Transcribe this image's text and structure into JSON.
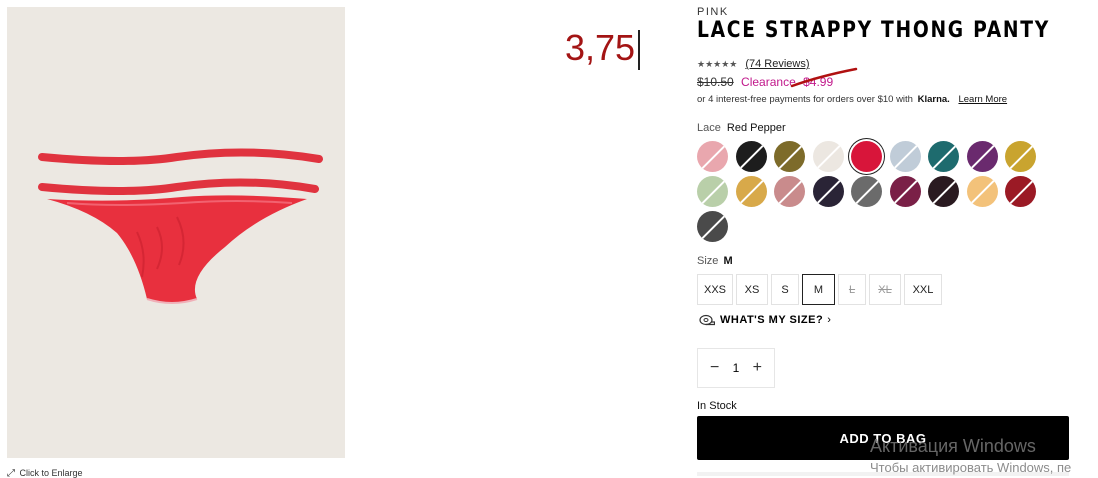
{
  "annotation": {
    "price_text": "3,75"
  },
  "product": {
    "brand": "PINK",
    "title": "LACE STRAPPY THONG PANTY",
    "rating_stars": "★★★★★",
    "reviews_link": "(74 Reviews)",
    "old_price": "$10.50",
    "clearance_label": "Clearance",
    "sale_price": "$4.99",
    "klarna_text": "or 4 interest-free payments for orders over $10 with",
    "klarna_brand": "Klarna.",
    "klarna_learn": "Learn More"
  },
  "image_footer": {
    "text": "Click to Enlarge"
  },
  "color": {
    "label": "Lace",
    "selected_value": "Red Pepper",
    "swatches": [
      {
        "name": "pink-floral",
        "color": "#e9a7ae"
      },
      {
        "name": "black",
        "color": "#1d1d1d"
      },
      {
        "name": "olive",
        "color": "#7d6b2a"
      },
      {
        "name": "ivory",
        "color": "#ece7e1"
      },
      {
        "name": "red-pepper",
        "color": "#d8153a"
      },
      {
        "name": "light-blue",
        "color": "#c0ccd8"
      },
      {
        "name": "teal",
        "color": "#1e6b6e"
      },
      {
        "name": "purple",
        "color": "#6a2a6e"
      },
      {
        "name": "mustard",
        "color": "#c9a42f"
      },
      {
        "name": "sage",
        "color": "#b9cfa9"
      },
      {
        "name": "gold",
        "color": "#d8a94a"
      },
      {
        "name": "rose-print",
        "color": "#c98b8c"
      },
      {
        "name": "dark-floral",
        "color": "#2a2436"
      },
      {
        "name": "grey-floral",
        "color": "#6b6b6b"
      },
      {
        "name": "magenta-floral",
        "color": "#7a2047"
      },
      {
        "name": "black-floral",
        "color": "#2a1a20"
      },
      {
        "name": "peach",
        "color": "#f3c27a"
      },
      {
        "name": "crimson",
        "color": "#9b1a25"
      },
      {
        "name": "black-white-floral",
        "color": "#4a4a4a"
      }
    ]
  },
  "size": {
    "label": "Size",
    "selected_value": "M",
    "options": [
      {
        "label": "XXS",
        "state": "available"
      },
      {
        "label": "XS",
        "state": "available"
      },
      {
        "label": "S",
        "state": "available"
      },
      {
        "label": "M",
        "state": "selected"
      },
      {
        "label": "L",
        "state": "unavailable"
      },
      {
        "label": "XL",
        "state": "unavailable"
      },
      {
        "label": "XXL",
        "state": "available"
      }
    ],
    "fit_link": "WHAT'S MY SIZE?",
    "fit_icon": "tape-measure-icon"
  },
  "quantity": {
    "minus": "−",
    "value": "1",
    "plus": "+"
  },
  "stock_status": "In Stock",
  "add_to_bag": "ADD TO BAG",
  "os_watermark": {
    "line1": "Активация Windows",
    "line2": "Чтобы активировать Windows, пе"
  },
  "colors": {
    "sale": "#c1188b",
    "annotation": "#a31414",
    "button_bg": "#000000"
  }
}
